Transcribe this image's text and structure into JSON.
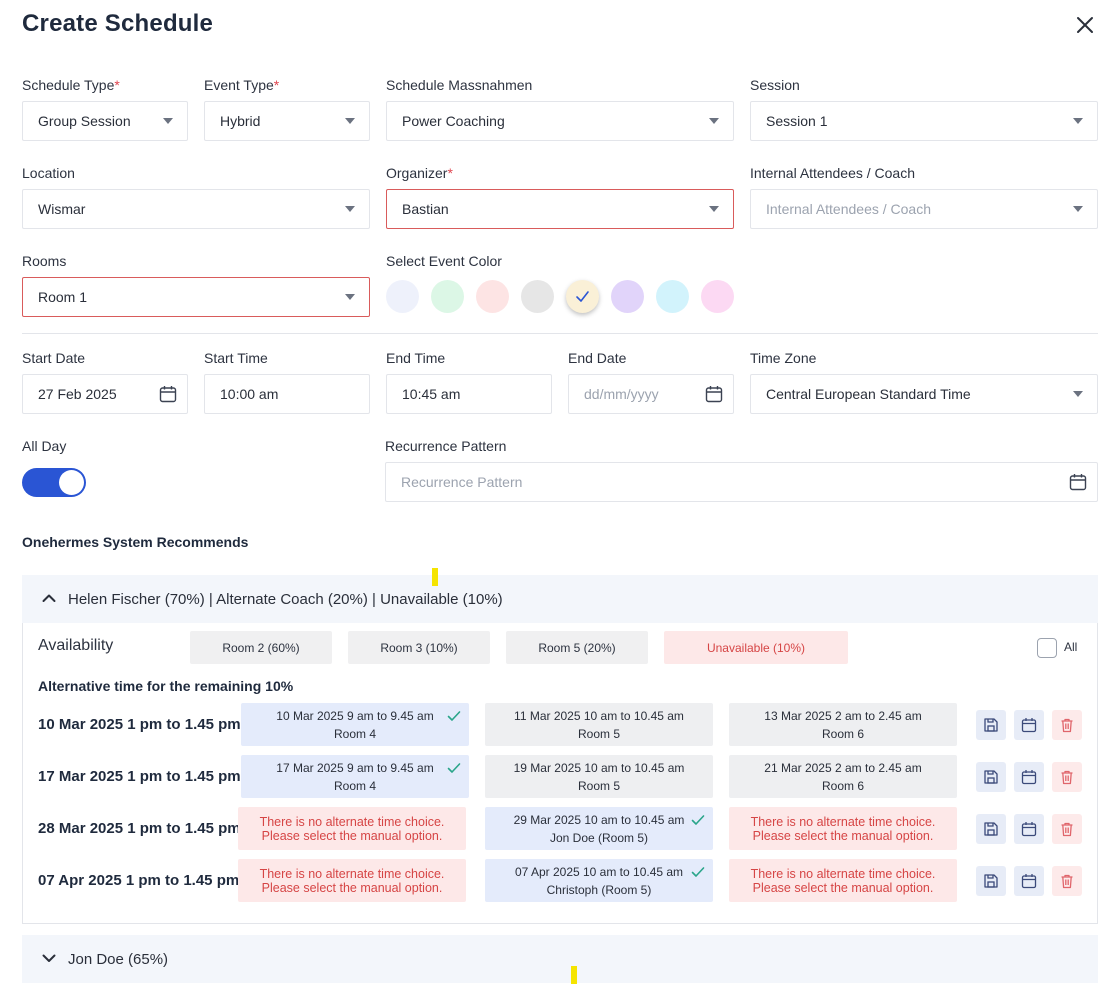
{
  "dialog": {
    "title": "Create Schedule"
  },
  "fields": {
    "schedule_type": {
      "label": "Schedule Type",
      "required_mark": "*",
      "value": "Group Session"
    },
    "event_type": {
      "label": "Event Type",
      "required_mark": "*",
      "value": "Hybrid"
    },
    "schedule_massnahmen": {
      "label": "Schedule Massnahmen",
      "value": "Power Coaching"
    },
    "session": {
      "label": "Session",
      "value": "Session 1"
    },
    "location": {
      "label": "Location",
      "value": "Wismar"
    },
    "organizer": {
      "label": "Organizer",
      "required_mark": "*",
      "value": "Bastian"
    },
    "internal_attendees": {
      "label": "Internal Attendees / Coach",
      "placeholder": "Internal Attendees / Coach"
    },
    "rooms": {
      "label": "Rooms",
      "value": "Room 1"
    },
    "event_color": {
      "label": "Select Event Color"
    },
    "start_date": {
      "label": "Start Date",
      "value": "27 Feb 2025"
    },
    "start_time": {
      "label": "Start Time",
      "value": "10:00 am"
    },
    "end_time": {
      "label": "End Time",
      "value": "10:45 am"
    },
    "end_date": {
      "label": "End Date",
      "placeholder": "dd/mm/yyyy"
    },
    "time_zone": {
      "label": "Time Zone",
      "value": "Central European Standard Time"
    },
    "all_day": {
      "label": "All Day",
      "on": true
    },
    "recurrence": {
      "label": "Recurrence Pattern",
      "placeholder": "Recurrence Pattern"
    }
  },
  "colors": [
    {
      "name": "lavender",
      "hex": "#eef1fb"
    },
    {
      "name": "mint",
      "hex": "#dcf7e6"
    },
    {
      "name": "pink",
      "hex": "#fde4e4"
    },
    {
      "name": "gray",
      "hex": "#e6e6e6"
    },
    {
      "name": "cream",
      "hex": "#faf0d7",
      "selected": true
    },
    {
      "name": "purple",
      "hex": "#e1d4fa"
    },
    {
      "name": "cyan",
      "hex": "#d2f3fc"
    },
    {
      "name": "magenta",
      "hex": "#fcd9f3"
    }
  ],
  "recommendations": {
    "heading": "Onehermes System Recommends",
    "coaches": [
      {
        "summary": "Helen Fischer (70%) | Alternate Coach (20%) | Unavailable (10%)",
        "expanded": true,
        "availability_label": "Availability",
        "rooms": [
          "Room 2 (60%)",
          "Room 3 (10%)",
          "Room 5 (20%)",
          "Unavailable (10%)"
        ],
        "all_label": "All",
        "alternative_heading": "Alternative time for the remaining 10%",
        "rows": [
          {
            "label": "10 Mar 2025 1 pm to 1.45 pm",
            "options": [
              {
                "line1": "10 Mar 2025 9 am to 9.45 am",
                "line2": "Room 4",
                "state": "selected"
              },
              {
                "line1": "11 Mar 2025 10 am to 10.45 am",
                "line2": "Room 5",
                "state": "available"
              },
              {
                "line1": "13 Mar 2025 2 am to 2.45 am",
                "line2": "Room 6",
                "state": "available"
              }
            ]
          },
          {
            "label": "17 Mar 2025 1 pm to 1.45 pm",
            "options": [
              {
                "line1": "17 Mar 2025 9 am to 9.45 am",
                "line2": "Room 4",
                "state": "selected"
              },
              {
                "line1": "19 Mar 2025 10 am to 10.45 am",
                "line2": "Room 5",
                "state": "available"
              },
              {
                "line1": "21 Mar 2025 2 am to 2.45 am",
                "line2": "Room 6",
                "state": "available"
              }
            ]
          },
          {
            "label": "28 Mar 2025 1 pm to 1.45 pm",
            "options": [
              {
                "line1": "There is no alternate time choice.",
                "line2": "Please select the manual option.",
                "state": "none"
              },
              {
                "line1": "29 Mar 2025 10 am to 10.45 am",
                "line2": "Jon Doe (Room 5)",
                "state": "selected"
              },
              {
                "line1": "There is no alternate time choice.",
                "line2": "Please select the manual option.",
                "state": "none"
              }
            ]
          },
          {
            "label": "07 Apr 2025 1 pm to 1.45 pm",
            "options": [
              {
                "line1": "There is no alternate time choice.",
                "line2": "Please select the manual option.",
                "state": "none"
              },
              {
                "line1": "07 Apr 2025 10 am to 10.45 am",
                "line2": "Christoph (Room 5)",
                "state": "selected"
              },
              {
                "line1": "There is no alternate time choice.",
                "line2": "Please select the manual option.",
                "state": "none"
              }
            ]
          }
        ]
      },
      {
        "summary": "Jon Doe (65%)",
        "expanded": false
      }
    ]
  },
  "theme": {
    "accent": "#2a55d4",
    "error": "#d64545",
    "check": "#2aa58a"
  }
}
